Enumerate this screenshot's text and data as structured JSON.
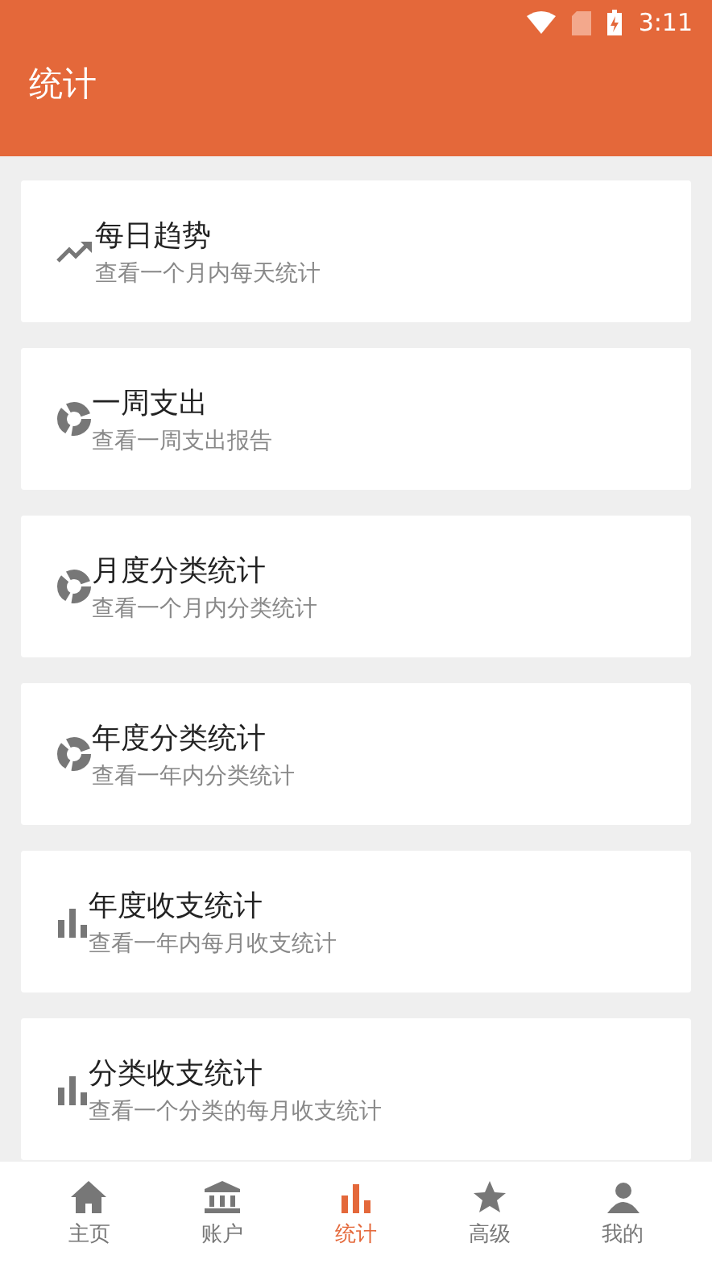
{
  "status_bar": {
    "time": "3:11"
  },
  "header": {
    "title": "统计"
  },
  "items": [
    {
      "kind": "trend",
      "title": "每日趋势",
      "subtitle": "查看一个月内每天统计"
    },
    {
      "kind": "pie",
      "title": "一周支出",
      "subtitle": "查看一周支出报告"
    },
    {
      "kind": "pie",
      "title": "月度分类统计",
      "subtitle": "查看一个月内分类统计"
    },
    {
      "kind": "pie",
      "title": "年度分类统计",
      "subtitle": "查看一年内分类统计"
    },
    {
      "kind": "bar",
      "title": "年度收支统计",
      "subtitle": "查看一年内每月收支统计"
    },
    {
      "kind": "bar",
      "title": "分类收支统计",
      "subtitle": "查看一个分类的每月收支统计"
    }
  ],
  "nav": [
    {
      "kind": "home",
      "label": "主页",
      "selected": false
    },
    {
      "kind": "bank",
      "label": "账户",
      "selected": false
    },
    {
      "kind": "chart",
      "label": "统计",
      "selected": true
    },
    {
      "kind": "star",
      "label": "高级",
      "selected": false
    },
    {
      "kind": "person",
      "label": "我的",
      "selected": false
    }
  ]
}
